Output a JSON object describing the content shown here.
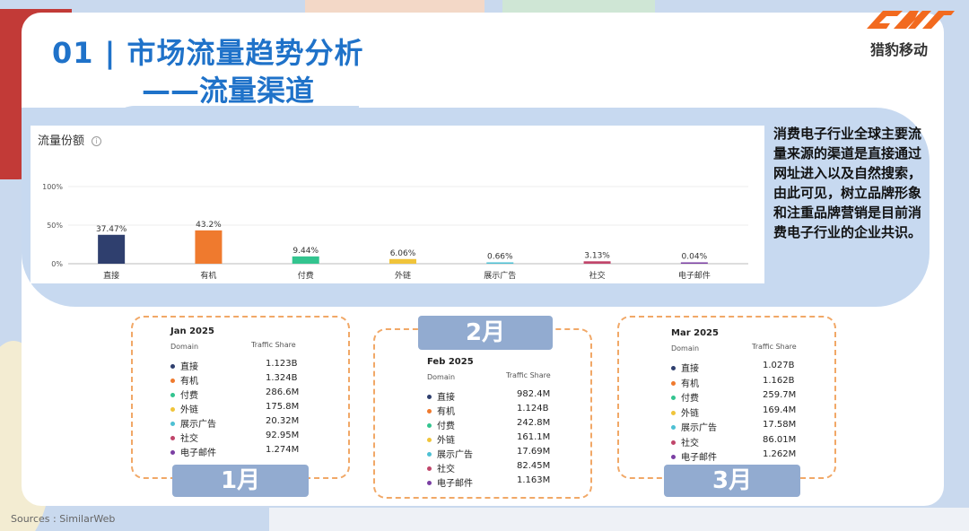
{
  "header": {
    "title_line1": "01 | 市场流量趋势分析",
    "title_line2": "——流量渠道",
    "brand": "猎豹移动"
  },
  "chart_data": {
    "type": "bar",
    "title": "流量份额",
    "categories": [
      "直接",
      "有机",
      "付费",
      "外链",
      "展示广告",
      "社交",
      "电子邮件"
    ],
    "values": [
      37.47,
      43.2,
      9.44,
      6.06,
      0.66,
      3.13,
      0.04
    ],
    "value_labels": [
      "37.47%",
      "43.2%",
      "9.44%",
      "6.06%",
      "0.66%",
      "3.13%",
      "0.04%"
    ],
    "colors": [
      "#2f3f6e",
      "#ef7a2e",
      "#33c48f",
      "#f0c43a",
      "#4dc0d3",
      "#c0456a",
      "#7b3fa3"
    ],
    "ylim": [
      0,
      100
    ],
    "yticks": [
      "0%",
      "50%",
      "100%"
    ],
    "grid": true
  },
  "side_note": "消费电子行业全球主要流量来源的渠道是直接通过网址进入以及自然搜索，由此可见，树立品牌形象和注重品牌营销是目前消费电子行业的企业共识。",
  "months": [
    {
      "label": "1月",
      "title": "Jan 2025",
      "col_domain": "Domain",
      "col_share": "Traffic Share",
      "rows": [
        {
          "name": "直接",
          "value": "1.123B",
          "color": "#2f3f6e"
        },
        {
          "name": "有机",
          "value": "1.324B",
          "color": "#ef7a2e"
        },
        {
          "name": "付费",
          "value": "286.6M",
          "color": "#33c48f"
        },
        {
          "name": "外链",
          "value": "175.8M",
          "color": "#f0c43a"
        },
        {
          "name": "展示广告",
          "value": "20.32M",
          "color": "#4dc0d3"
        },
        {
          "name": "社交",
          "value": "92.95M",
          "color": "#c0456a"
        },
        {
          "name": "电子邮件",
          "value": "1.274M",
          "color": "#7b3fa3"
        }
      ]
    },
    {
      "label": "2月",
      "title": "Feb 2025",
      "col_domain": "Domain",
      "col_share": "Traffic Share",
      "rows": [
        {
          "name": "直接",
          "value": "982.4M",
          "color": "#2f3f6e"
        },
        {
          "name": "有机",
          "value": "1.124B",
          "color": "#ef7a2e"
        },
        {
          "name": "付费",
          "value": "242.8M",
          "color": "#33c48f"
        },
        {
          "name": "外链",
          "value": "161.1M",
          "color": "#f0c43a"
        },
        {
          "name": "展示广告",
          "value": "17.69M",
          "color": "#4dc0d3"
        },
        {
          "name": "社交",
          "value": "82.45M",
          "color": "#c0456a"
        },
        {
          "name": "电子邮件",
          "value": "1.163M",
          "color": "#7b3fa3"
        }
      ]
    },
    {
      "label": "3月",
      "title": "Mar 2025",
      "col_domain": "Domain",
      "col_share": "Traffic Share",
      "rows": [
        {
          "name": "直接",
          "value": "1.027B",
          "color": "#2f3f6e"
        },
        {
          "name": "有机",
          "value": "1.162B",
          "color": "#ef7a2e"
        },
        {
          "name": "付费",
          "value": "259.7M",
          "color": "#33c48f"
        },
        {
          "name": "外链",
          "value": "169.4M",
          "color": "#f0c43a"
        },
        {
          "name": "展示广告",
          "value": "17.58M",
          "color": "#4dc0d3"
        },
        {
          "name": "社交",
          "value": "86.01M",
          "color": "#c0456a"
        },
        {
          "name": "电子邮件",
          "value": "1.262M",
          "color": "#7b3fa3"
        }
      ]
    }
  ],
  "footer": {
    "source": "Sources : SimilarWeb"
  }
}
